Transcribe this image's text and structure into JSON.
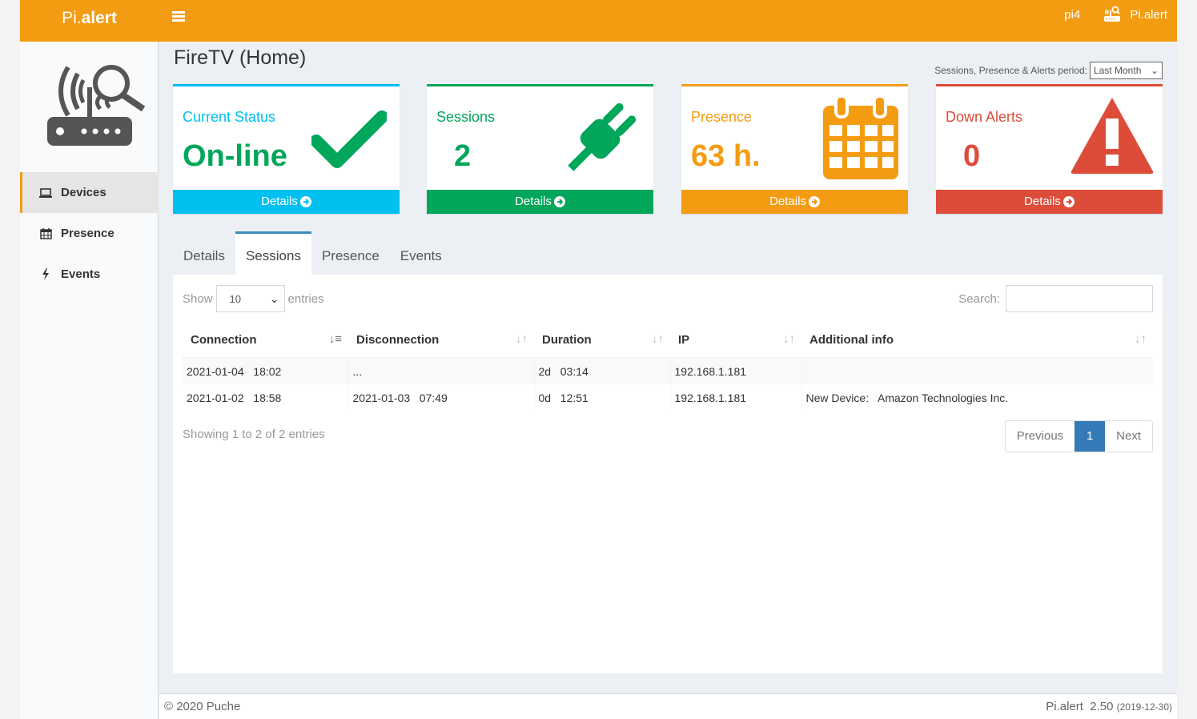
{
  "app": {
    "logo_light": "Pi.",
    "logo_bold": "alert",
    "host": "pi4",
    "user_name": "Pi.alert"
  },
  "sidebar": {
    "items": [
      {
        "label": "Devices",
        "icon": "laptop-icon"
      },
      {
        "label": "Presence",
        "icon": "calendar-icon"
      },
      {
        "label": "Events",
        "icon": "bolt-icon"
      }
    ]
  },
  "page": {
    "title": "FireTV (Home)",
    "period_label": "Sessions, Presence & Alerts period:",
    "period_value": "Last Month"
  },
  "boxes": {
    "status": {
      "title": "Current Status",
      "value": "On-line",
      "footer": "Details",
      "color": "#00c0ef",
      "text_color": "#3c8dbc",
      "value_color": "#00a65a"
    },
    "sessions": {
      "title": "Sessions",
      "value": "2",
      "footer": "Details",
      "color": "#00a65a"
    },
    "presence": {
      "title": "Presence",
      "value": "63 h.",
      "footer": "Details",
      "color": "#f39c12"
    },
    "alerts": {
      "title": "Down Alerts",
      "value": "0",
      "footer": "Details",
      "color": "#dd4b39"
    }
  },
  "tabs": [
    "Details",
    "Sessions",
    "Presence",
    "Events"
  ],
  "active_tab": "Sessions",
  "table_controls": {
    "show": "Show",
    "length": "10",
    "entries": "entries",
    "search_label": "Search:"
  },
  "table": {
    "columns": [
      "Connection",
      "Disconnection",
      "Duration",
      "IP",
      "Additional info"
    ],
    "rows": [
      [
        "2021-01-04   18:02",
        "...",
        "2d   03:14",
        "192.168.1.181",
        ""
      ],
      [
        "2021-01-02   18:58",
        "2021-01-03   07:49",
        "0d   12:51",
        "192.168.1.181",
        "New Device:   Amazon Technologies Inc."
      ]
    ],
    "info": "Showing 1 to 2 of 2 entries",
    "pager": {
      "prev": "Previous",
      "current": "1",
      "next": "Next"
    }
  },
  "footer": {
    "copyright": "© 2020 Puche",
    "version": "Pi.alert  2.50",
    "date": "(2019-12-30)"
  }
}
